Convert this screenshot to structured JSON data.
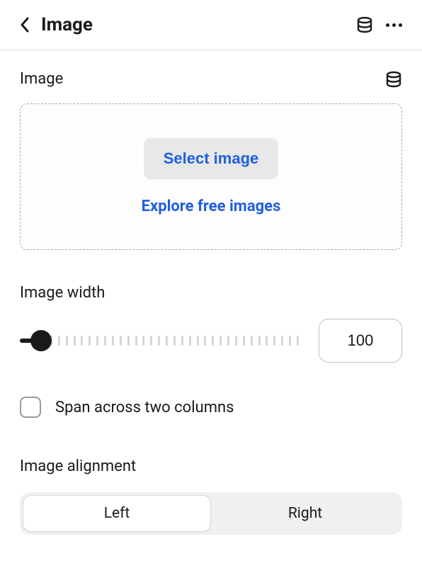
{
  "header": {
    "title": "Image"
  },
  "image": {
    "section_label": "Image",
    "select_button": "Select image",
    "explore_link": "Explore free images"
  },
  "width": {
    "label": "Image width",
    "value": "100"
  },
  "span": {
    "label": "Span across two columns",
    "checked": false
  },
  "alignment": {
    "label": "Image alignment",
    "options": {
      "left": "Left",
      "right": "Right"
    },
    "selected": "left"
  }
}
